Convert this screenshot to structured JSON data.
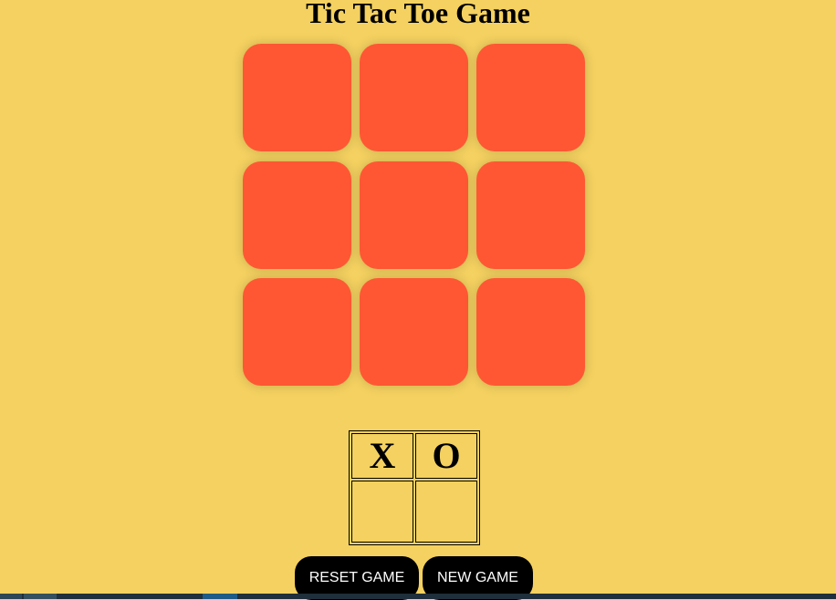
{
  "header": {
    "title": "Tic Tac Toe Game"
  },
  "board": {
    "cells": [
      "",
      "",
      "",
      "",
      "",
      "",
      "",
      "",
      ""
    ],
    "cell_color": "#FF5733"
  },
  "scoreboard": {
    "headers": [
      "X",
      "O"
    ],
    "scores": [
      "",
      ""
    ]
  },
  "controls": {
    "reset_label": "RESET GAME",
    "new_game_label": "NEW GAME"
  },
  "colors": {
    "background": "#F4D160",
    "cell": "#FF5733",
    "button": "#000000",
    "button_text": "#FFFFFF"
  }
}
